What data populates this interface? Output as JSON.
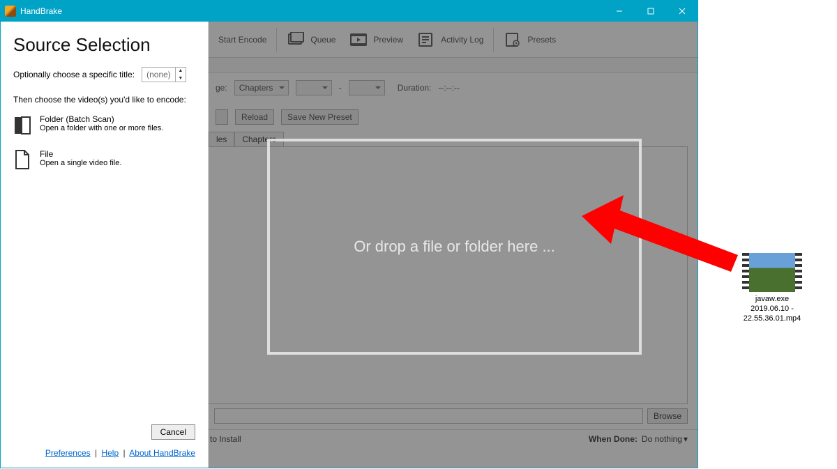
{
  "title": "HandBrake",
  "toolbar": {
    "start_encode": "Start Encode",
    "queue": "Queue",
    "preview": "Preview",
    "activity_log": "Activity Log",
    "presets": "Presets"
  },
  "source_row": {
    "ge_suffix": "ge:",
    "chapters": "Chapters",
    "dash": "-",
    "duration_label": "Duration:",
    "duration_value": "--:--:--"
  },
  "preset_buttons": {
    "reload": "Reload",
    "save_new": "Save New Preset"
  },
  "tabs": {
    "subs": "les",
    "chapters": "Chapters"
  },
  "bottom": {
    "browse": "Browse",
    "status": "to Install",
    "when_done_label": "When Done:",
    "when_done_value": "Do nothing"
  },
  "drop_text": "Or drop a file or folder here ...",
  "panel": {
    "heading": "Source Selection",
    "title_label": "Optionally choose a specific title:",
    "title_value": "(none)",
    "subhead": "Then choose the video(s) you'd like to encode:",
    "folder_t1": "Folder (Batch Scan)",
    "folder_t2": "Open a folder with one or more files.",
    "file_t1": "File",
    "file_t2": "Open a single video file.",
    "cancel": "Cancel",
    "links": {
      "prefs": "Preferences",
      "help": "Help",
      "about": "About HandBrake"
    }
  },
  "desktop_file": {
    "line1": "javaw.exe",
    "line2": "2019.06.10 -",
    "line3": "22.55.36.01.mp4"
  }
}
